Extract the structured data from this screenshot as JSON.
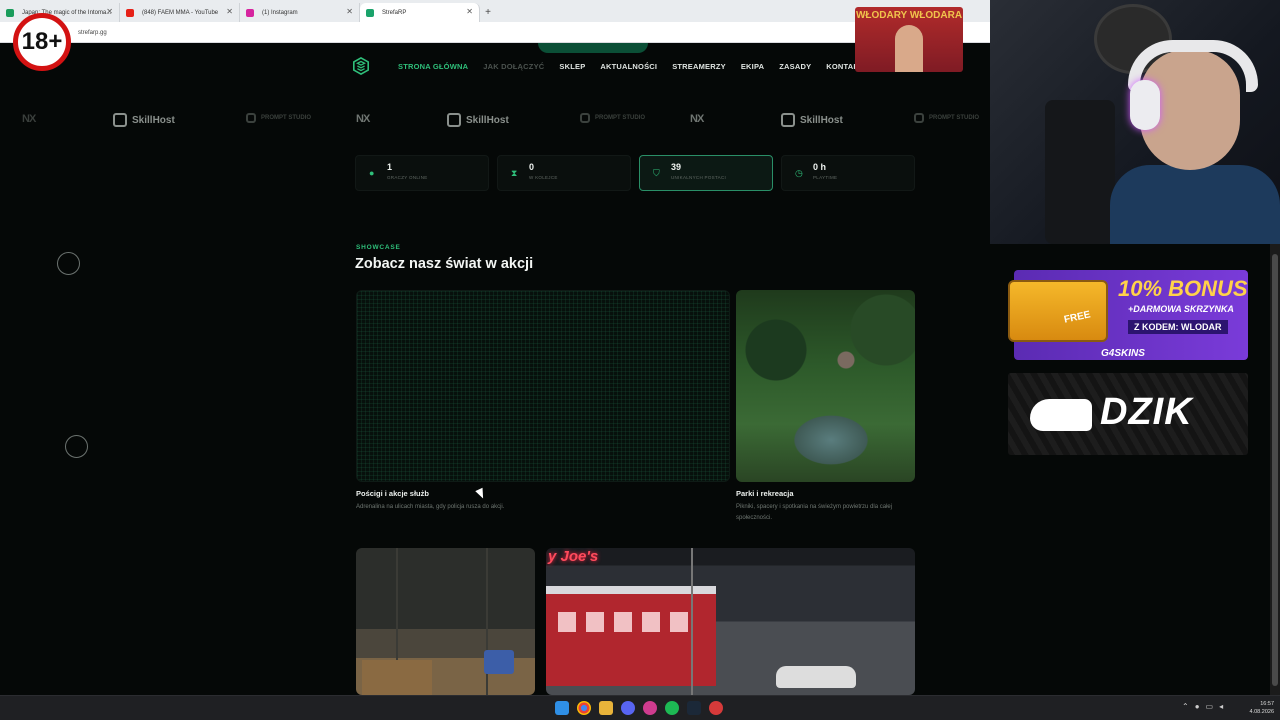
{
  "browser": {
    "tabs": [
      {
        "label": "Japan: The magic of the Intoma...",
        "icon_color": "#1a9c5b"
      },
      {
        "label": "(848) FAEM MMA - YouTube",
        "icon_color": "#e62117"
      },
      {
        "label": "(1) Instagram",
        "icon_color": "#d6249f"
      },
      {
        "label": "StrefaRP",
        "icon_color": "#1aa36b",
        "active": true
      }
    ],
    "new_tab": "+",
    "url": "strefarp.gg"
  },
  "age_badge": "18+",
  "site": {
    "nav": {
      "items": [
        {
          "label": "STRONA GŁÓWNA",
          "state": "active"
        },
        {
          "label": "JAK DOŁĄCZYĆ",
          "state": "dim"
        },
        {
          "label": "SKLEP",
          "state": "normal"
        },
        {
          "label": "AKTUALNOŚCI",
          "state": "normal"
        },
        {
          "label": "STREAMERZY",
          "state": "normal"
        },
        {
          "label": "EKIPA",
          "state": "normal"
        },
        {
          "label": "ZASADY",
          "state": "normal"
        },
        {
          "label": "KONTAKT",
          "state": "normal"
        }
      ]
    },
    "sponsors": {
      "skillhost": "SkillHost",
      "prompt": "PROMPT STUDIO",
      "nx": "NX"
    },
    "stats": [
      {
        "value": "1",
        "label": "graczy online",
        "icon": "user-icon"
      },
      {
        "value": "0",
        "label": "w kolejce",
        "icon": "hourglass-icon"
      },
      {
        "value": "39",
        "label": "unikalnych postaci",
        "icon": "shield-icon",
        "highlight": true
      },
      {
        "value": "0 h",
        "label": "playtime",
        "icon": "clock-icon"
      }
    ],
    "showcase": {
      "eyebrow": "SHOWCASE",
      "heading": "Zobacz nasz świat w akcji",
      "cards": [
        {
          "title": "Pościgi i akcje służb",
          "desc": "Adrenalina na ulicach miasta, gdy policja rusza do akcji."
        },
        {
          "title": "Parki i rekreacja",
          "desc": "Pikniki, spacery i spotkania na świeżym powietrzu dla całej społeczności."
        }
      ],
      "diner_sign": "y Joe's"
    }
  },
  "overlay": {
    "poster_text": "WŁODARY WŁODARA",
    "bonus": {
      "headline": "10% BONUS",
      "sub": "+DARMOWA SKRZYNKA",
      "code": "Z KODEM: WLODAR",
      "brand": "G4SKINS",
      "chest_label": "FREE"
    },
    "dzik": "DZIK"
  },
  "taskbar": {
    "time": "16:57",
    "date": "4.08.2026"
  }
}
